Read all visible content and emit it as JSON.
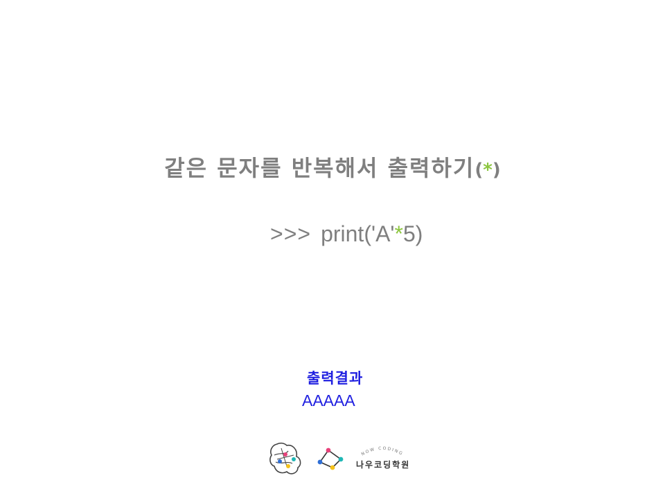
{
  "slide": {
    "title_text": "같은 문자를 반복해서 출력하기",
    "title_paren_open": "(",
    "title_star": "*",
    "title_paren_close": ")",
    "code_prompt": ">>>",
    "code_before": "print('A'",
    "code_star": "*",
    "code_after": "5)",
    "result_label": "출력결과",
    "result_value": "AAAAA"
  },
  "brand": {
    "tagline": "NOW CODING",
    "name": "나우코딩학원",
    "logo_icons": [
      "brain-logo-icon",
      "diamond-network-icon"
    ]
  },
  "colors": {
    "title_gray": "#7f7f7f",
    "accent_green": "#8cc63f",
    "result_blue": "#1f1fe0",
    "dot_pink": "#e8417a",
    "dot_teal": "#1fb7b5",
    "dot_blue": "#2f6fd6",
    "dot_yellow": "#f5c21b"
  }
}
